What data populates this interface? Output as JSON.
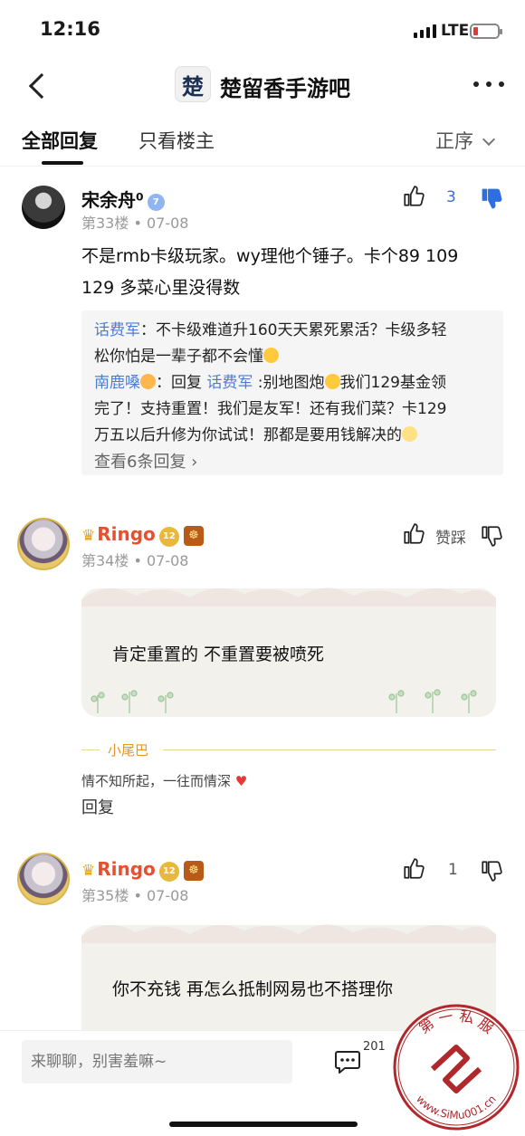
{
  "status": {
    "time": "12:16",
    "network": "LTE"
  },
  "nav": {
    "forum_name": "楚留香手游吧",
    "forum_logo_text": "楚"
  },
  "tabs": {
    "all": "全部回复",
    "op_only": "只看楼主",
    "order": "正序"
  },
  "posts": [
    {
      "user": "宋余舟⁰",
      "level": "7",
      "floor": "第33楼",
      "date": "07-08",
      "text_line1": "不是rmb卡级玩家。wy理他个锤子。卡个89 109",
      "text_line2": "129 多菜心里没得数",
      "likes": "3",
      "subreplies": [
        {
          "name": "话费军",
          "text1": "：不卡级难道升160天天累死累活？卡级多轻",
          "text2": "松你怕是一辈子都不会懂"
        },
        {
          "name": "南鹿嗓",
          "reply_word": "：回复 ",
          "target": "话费军",
          "text1": " :别地图炮",
          "text1b": "我们129基金领",
          "text2": "完了！支持重置！我们是友军！还有我们菜？卡129",
          "text3": "万五以后升修为你试试！那都是要用钱解决的"
        }
      ],
      "more_replies": "查看6条回复 ›"
    },
    {
      "user": "Ringo",
      "level": "12",
      "medal": "☸",
      "floor": "第34楼",
      "date": "07-08",
      "text": "肯定重置的 不重置要被喷死",
      "vote_label": "赞踩",
      "tail_label": "小尾巴",
      "signature": "情不知所起，一往而情深",
      "reply": "回复"
    },
    {
      "user": "Ringo",
      "level": "12",
      "medal": "☸",
      "floor": "第35楼",
      "date": "07-08",
      "text": "你不充钱 再怎么抵制网易也不搭理你",
      "likes": "1"
    }
  ],
  "bottom": {
    "input_placeholder": "来聊聊，别害羞嘛~",
    "comment_count": "201"
  },
  "watermark": {
    "top_text": "第 一 私 服",
    "bottom_text": "www.SiMu001.cn"
  },
  "colors": {
    "accent_blue": "#3b6fd6",
    "username_orange": "#e8502d",
    "like_blue": "#2d6ee0"
  },
  "icons": [
    "back-icon",
    "more-icon",
    "chevron-down-icon",
    "thumb-up-icon",
    "thumb-down-icon",
    "comment-icon",
    "heart-icon",
    "crown-icon"
  ]
}
